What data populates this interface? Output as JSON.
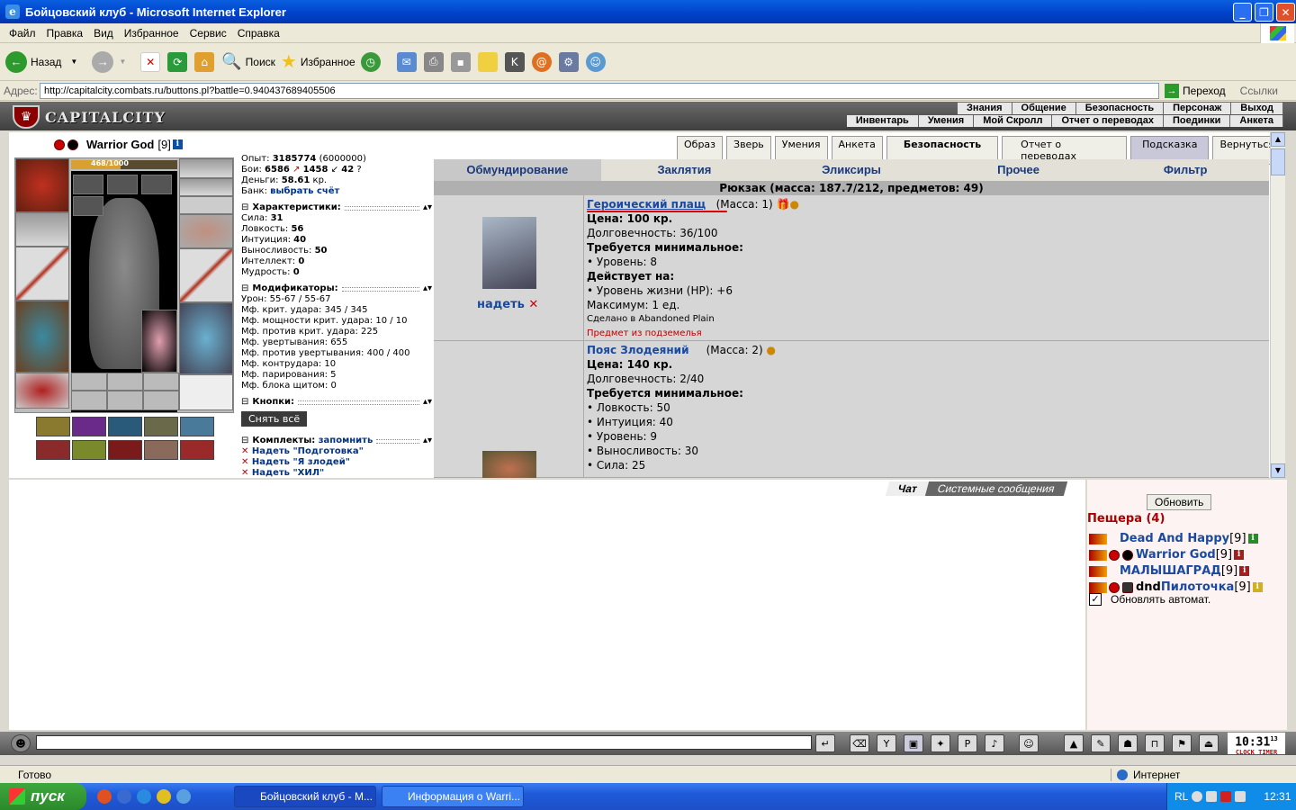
{
  "window": {
    "title": "Бойцовский клуб - Microsoft Internet Explorer"
  },
  "menu": [
    "Файл",
    "Правка",
    "Вид",
    "Избранное",
    "Сервис",
    "Справка"
  ],
  "toolbar": {
    "back": "Назад",
    "search": "Поиск",
    "favorites": "Избранное"
  },
  "address": {
    "label": "Адрес:",
    "url": "http://capitalcity.combats.ru/buttons.pl?battle=0.940437689405506",
    "go": "Переход",
    "links": "Ссылки"
  },
  "game": {
    "logo": "CAPITALCITY",
    "nav_top": [
      "Знания",
      "Общение",
      "Безопасность",
      "Персонаж",
      "Выход"
    ],
    "nav_bottom": [
      "Инвентарь",
      "Умения",
      "Мой Скролл",
      "Отчет о переводах",
      "Поединки",
      "Анкета"
    ],
    "character": {
      "name": "Warrior God",
      "level": "[9]",
      "hp": "468/1000",
      "hp_fraction": 0.468
    },
    "stats": {
      "exp": "Опыт: ",
      "exp_val": "3185774",
      "exp_next": " (6000000)",
      "battles": "Бои: ",
      "battles_win": "6586",
      "battles_loss": "1458",
      "battles_draw": "42",
      "money": "Деньги: ",
      "money_val": "58.61",
      "money_unit": " кр.",
      "bank": "Банк: ",
      "bank_link": "выбрать счёт",
      "chars_title": "Характеристики:",
      "chars": [
        [
          "Сила: ",
          "31"
        ],
        [
          "Ловкость: ",
          "56"
        ],
        [
          "Интуиция: ",
          "40"
        ],
        [
          "Выносливость: ",
          "50"
        ],
        [
          "Интеллект: ",
          "0"
        ],
        [
          "Мудрость: ",
          "0"
        ]
      ],
      "mods_title": "Модификаторы:",
      "mods": [
        "Урон: 55-67 / 55-67",
        "Мф. крит. удара: 345 / 345",
        "Мф. мощности крит. удара: 10 / 10",
        "Мф. против крит. удара: 225",
        "Мф. увертывания: 655",
        "Мф. против увертывания: 400 / 400",
        "Мф. контрудара: 10",
        "Мф. парирования: 5",
        "Мф. блока щитом: 0"
      ],
      "buttons_title": "Кнопки:",
      "remove_all": "Снять всё",
      "kits_title": "Комплекты:",
      "kits_remember": "запомнить",
      "kits": [
        "Надеть \"Подготовка\"",
        "Надеть \"Я злодей\"",
        "Надеть \"ХИЛ\""
      ]
    },
    "top_buttons": [
      "Образ",
      "Зверь",
      "Умения",
      "Анкета",
      "Безопасность",
      "Отчет о переводах",
      "Подсказка",
      "Вернуться"
    ],
    "tabs": [
      "Обмундирование",
      "Заклятия",
      "Эликсиры",
      "Прочее",
      "Фильтр"
    ],
    "bag": "Рюкзак (масса: 187.7/212, предметов: 49)",
    "items": [
      {
        "name": "Героический плащ",
        "mass": "(Масса: 1)",
        "price": "Цена: 100 кр.",
        "durability": "Долговечность: 36/100",
        "req_title": "Требуется минимальное:",
        "req": [
          "• Уровень: 8"
        ],
        "acts_title": "Действует на:",
        "acts": [
          "• Уровень жизни (HP): +6"
        ],
        "max": "Максимум: 1 ед.",
        "made": "Сделано в Abandoned Plain",
        "note": "Предмет из подземелья",
        "wear": "надеть"
      },
      {
        "name": "Пояс Злодеяний",
        "mass": "(Масса: 2)",
        "price": "Цена: 140 кр.",
        "durability": "Долговечность: 2/40",
        "req_title": "Требуется минимальное:",
        "req": [
          "• Ловкость: 50",
          "• Интуиция: 40",
          "• Уровень: 9",
          "• Выносливость: 30",
          "• Сила: 25"
        ]
      }
    ],
    "chat_tabs": [
      "Чат",
      "Системные сообщения"
    ],
    "right": {
      "refresh": "Обновить",
      "location": "Пещера (4)",
      "users": [
        {
          "prefix": "",
          "name": "Dead And Happy",
          "level": "[9]"
        },
        {
          "prefix": "",
          "name": "Warrior God",
          "level": "[9]"
        },
        {
          "prefix": "",
          "name": "МАЛЫШАГРАД",
          "level": "[9]"
        },
        {
          "prefix": "dnd ",
          "name": "Пилоточка",
          "level": "[9]"
        }
      ],
      "auto": "Обновлять автомат."
    },
    "clock": {
      "time": "10:31",
      "sec": "13",
      "label": "CLOCK TIMER"
    }
  },
  "status": {
    "ready": "Готово",
    "zone": "Интернет"
  },
  "taskbar": {
    "start": "пуск",
    "tasks": [
      "Бойцовский клуб - M...",
      "Информация о Warri..."
    ],
    "lang": "RL",
    "time": "12:31"
  }
}
